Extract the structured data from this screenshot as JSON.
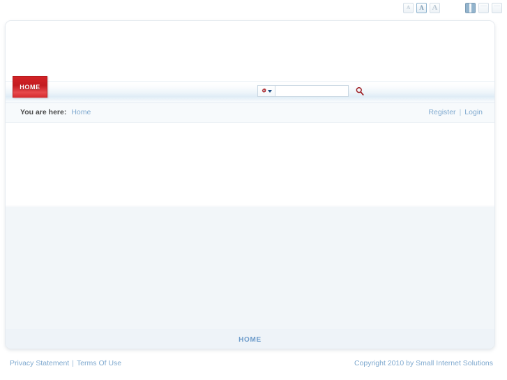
{
  "controls": {
    "text_size": {
      "label": "text-size-selector",
      "options": [
        {
          "name": "small",
          "glyph": "A",
          "selected": false
        },
        {
          "name": "medium",
          "glyph": "A",
          "selected": true
        },
        {
          "name": "large",
          "glyph": "A",
          "selected": false
        }
      ]
    },
    "layout": {
      "label": "layout-selector",
      "options": [
        {
          "name": "fixed-width",
          "selected": true
        },
        {
          "name": "wide",
          "selected": false
        },
        {
          "name": "full-width",
          "selected": false
        }
      ]
    }
  },
  "nav": {
    "tabs": [
      {
        "label": "HOME",
        "active": true
      }
    ]
  },
  "search": {
    "type_icon": "gear-icon",
    "dropdown_icon": "chevron-down-icon",
    "value": "",
    "placeholder": "",
    "submit_icon": "search-icon"
  },
  "breadcrumb": {
    "label": "You are here:",
    "items": [
      {
        "label": "Home"
      }
    ]
  },
  "user_links": {
    "register": "Register",
    "separator": "|",
    "login": "Login"
  },
  "bottom_nav": {
    "items": [
      {
        "label": "HOME"
      }
    ]
  },
  "footer": {
    "privacy": "Privacy Statement",
    "separator": "|",
    "terms": "Terms Of Use",
    "copyright": "Copyright 2010 by Small Internet Solutions"
  },
  "colors": {
    "accent_red": "#c41b20",
    "link_blue": "#7fa9cf",
    "nav_blue": "#dfecf6",
    "panel_bg": "#f2f6f9"
  }
}
